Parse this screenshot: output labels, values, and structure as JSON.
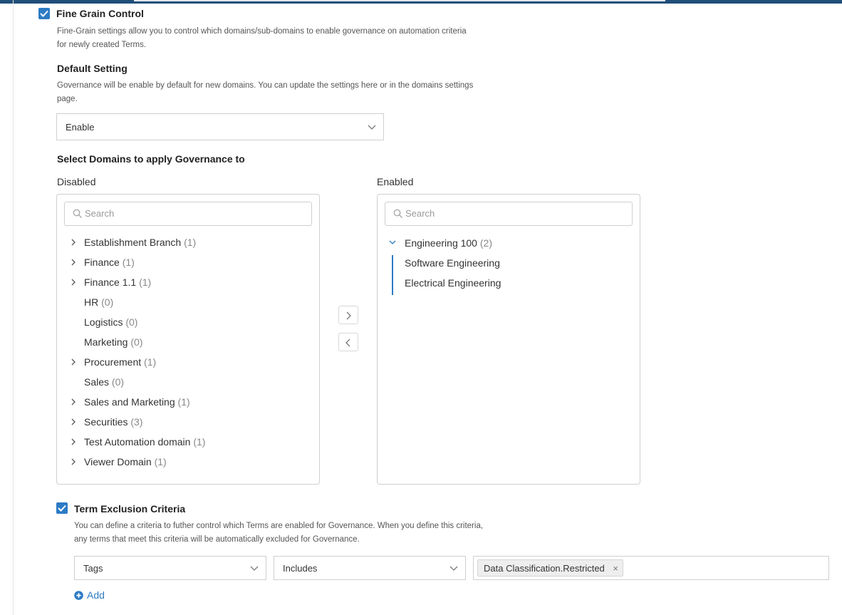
{
  "fine_grain": {
    "checked": true,
    "title": "Fine Grain Control",
    "description_line1": "Fine-Grain settings allow you to control which domains/sub-domains to enable governance on automation criteria",
    "description_line2": "for newly created Terms."
  },
  "default_setting": {
    "title": "Default Setting",
    "description_line1": "Governance will be enable by default for new domains. You can update the settings here or in the domains settings",
    "description_line2": "page.",
    "selected": "Enable"
  },
  "domains": {
    "title": "Select Domains to apply Governance to",
    "disabled": {
      "label": "Disabled",
      "search_placeholder": "Search",
      "items": [
        {
          "name": "Establishment Branch",
          "count": "(1)",
          "expandable": true
        },
        {
          "name": "Finance",
          "count": "(1)",
          "expandable": true
        },
        {
          "name": "Finance 1.1",
          "count": "(1)",
          "expandable": true
        },
        {
          "name": "HR",
          "count": "(0)",
          "expandable": false
        },
        {
          "name": "Logistics",
          "count": "(0)",
          "expandable": false
        },
        {
          "name": "Marketing",
          "count": "(0)",
          "expandable": false
        },
        {
          "name": "Procurement",
          "count": "(1)",
          "expandable": true
        },
        {
          "name": "Sales",
          "count": "(0)",
          "expandable": false
        },
        {
          "name": "Sales and Marketing",
          "count": "(1)",
          "expandable": true
        },
        {
          "name": "Securities",
          "count": "(3)",
          "expandable": true
        },
        {
          "name": "Test Automation domain",
          "count": "(1)",
          "expandable": true
        },
        {
          "name": "Viewer Domain",
          "count": "(1)",
          "expandable": true
        }
      ]
    },
    "enabled": {
      "label": "Enabled",
      "search_placeholder": "Search",
      "parent": {
        "name": "Engineering 100",
        "count": "(2)",
        "expanded": true
      },
      "children": [
        "Software Engineering",
        "Electrical Engineering"
      ]
    }
  },
  "exclusion": {
    "checked": true,
    "title": "Term Exclusion Criteria",
    "description_line1": "You can define a criteria to futher control which Terms are enabled for Governance. When you define this criteria,",
    "description_line2": "any terms that meet this criteria will be automatically excluded for Governance.",
    "field": "Tags",
    "operator": "Includes",
    "value_tag": "Data Classification.Restricted",
    "add_label": "Add"
  },
  "colors": {
    "accent": "#2d7bc4",
    "topbar": "#1f4e79"
  }
}
